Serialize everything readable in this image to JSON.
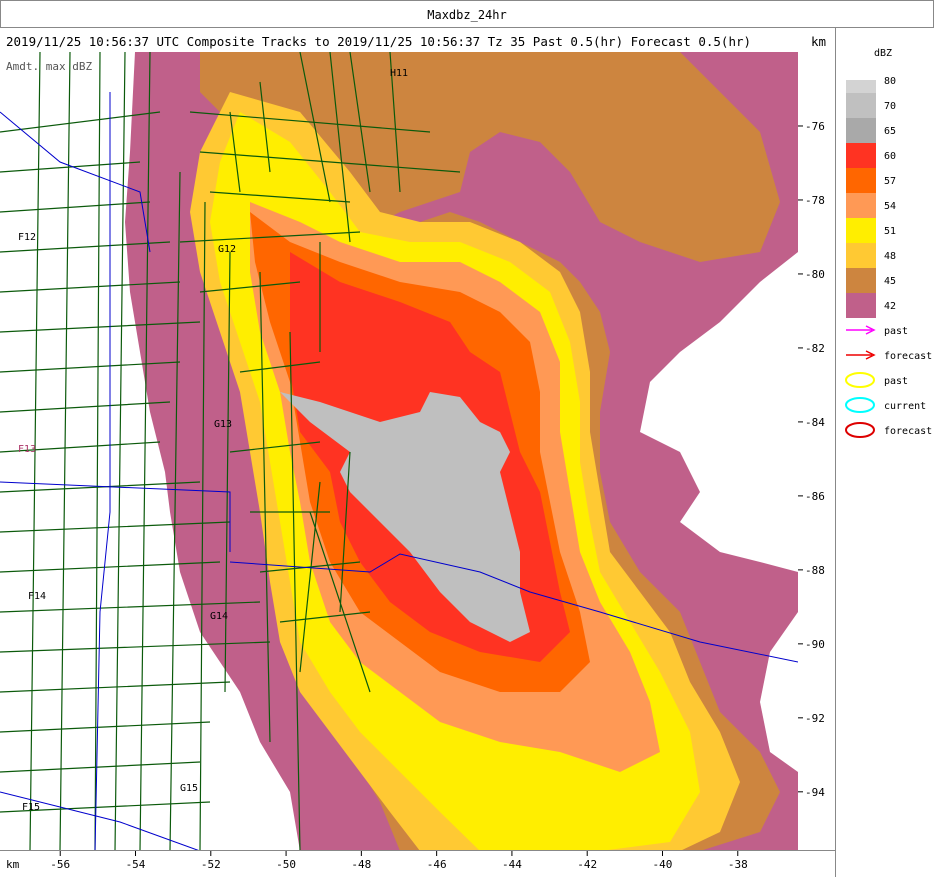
{
  "window": {
    "title": "Maxdbz_24hr"
  },
  "header": {
    "subtitle": "2019/11/25 10:56:37 UTC Composite Tracks to 2019/11/25 10:56:37 Tz 35 Past 0.5(hr) Forecast 0.5(hr)",
    "y_unit": "km",
    "x_unit": "km"
  },
  "map": {
    "layer_label": "Amdt. max dBZ",
    "axes": {
      "x_ticks": [
        "-56",
        "-54",
        "-52",
        "-50",
        "-48",
        "-46",
        "-44",
        "-42",
        "-40",
        "-38"
      ],
      "y_ticks": [
        "-76",
        "-78",
        "-80",
        "-82",
        "-84",
        "-86",
        "-88",
        "-90",
        "-92",
        "-94"
      ],
      "x_range": [
        -57.6,
        -36.4
      ],
      "y_range": [
        -74.0,
        -95.6
      ]
    },
    "grid_labels": [
      {
        "text": "H11",
        "x": -37.5,
        "y": -75.0
      },
      {
        "text": "F12",
        "x": -56.7,
        "y": -79.7
      },
      {
        "text": "G12",
        "x": -51.4,
        "y": -80.0
      },
      {
        "text": "G13",
        "x": -51.7,
        "y": -84.2
      },
      {
        "text": "F13",
        "x": -57.1,
        "y": -84.9
      },
      {
        "text": "F14",
        "x": -56.6,
        "y": -88.8
      },
      {
        "text": "G14",
        "x": -51.8,
        "y": -89.5
      },
      {
        "text": "G15",
        "x": -52.8,
        "y": -93.9
      },
      {
        "text": "F15",
        "x": -56.9,
        "y": -94.4
      }
    ]
  },
  "legend": {
    "title": "dBZ",
    "levels": [
      {
        "value": "80",
        "color": "#d3d3d3"
      },
      {
        "value": "70",
        "color": "#c0c0c0"
      },
      {
        "value": "65",
        "color": "#a9a9a9"
      },
      {
        "value": "60",
        "color": "#ff3322"
      },
      {
        "value": "57",
        "color": "#ff6600"
      },
      {
        "value": "54",
        "color": "#ff9955"
      },
      {
        "value": "51",
        "color": "#ffee00"
      },
      {
        "value": "48",
        "color": "#ffc933"
      },
      {
        "value": "45",
        "color": "#cd853f"
      },
      {
        "value": "42",
        "color": "#c0608a"
      }
    ],
    "tracks": [
      {
        "label": "past",
        "kind": "arrow",
        "color": "#ff00ff"
      },
      {
        "label": "forecast",
        "kind": "arrow",
        "color": "#ee0000"
      },
      {
        "label": "past",
        "kind": "ellipse",
        "color": "#ffff00"
      },
      {
        "label": "current",
        "kind": "ellipse",
        "color": "#00ffff"
      },
      {
        "label": "forecast",
        "kind": "ellipse",
        "color": "#dd0000"
      }
    ]
  }
}
